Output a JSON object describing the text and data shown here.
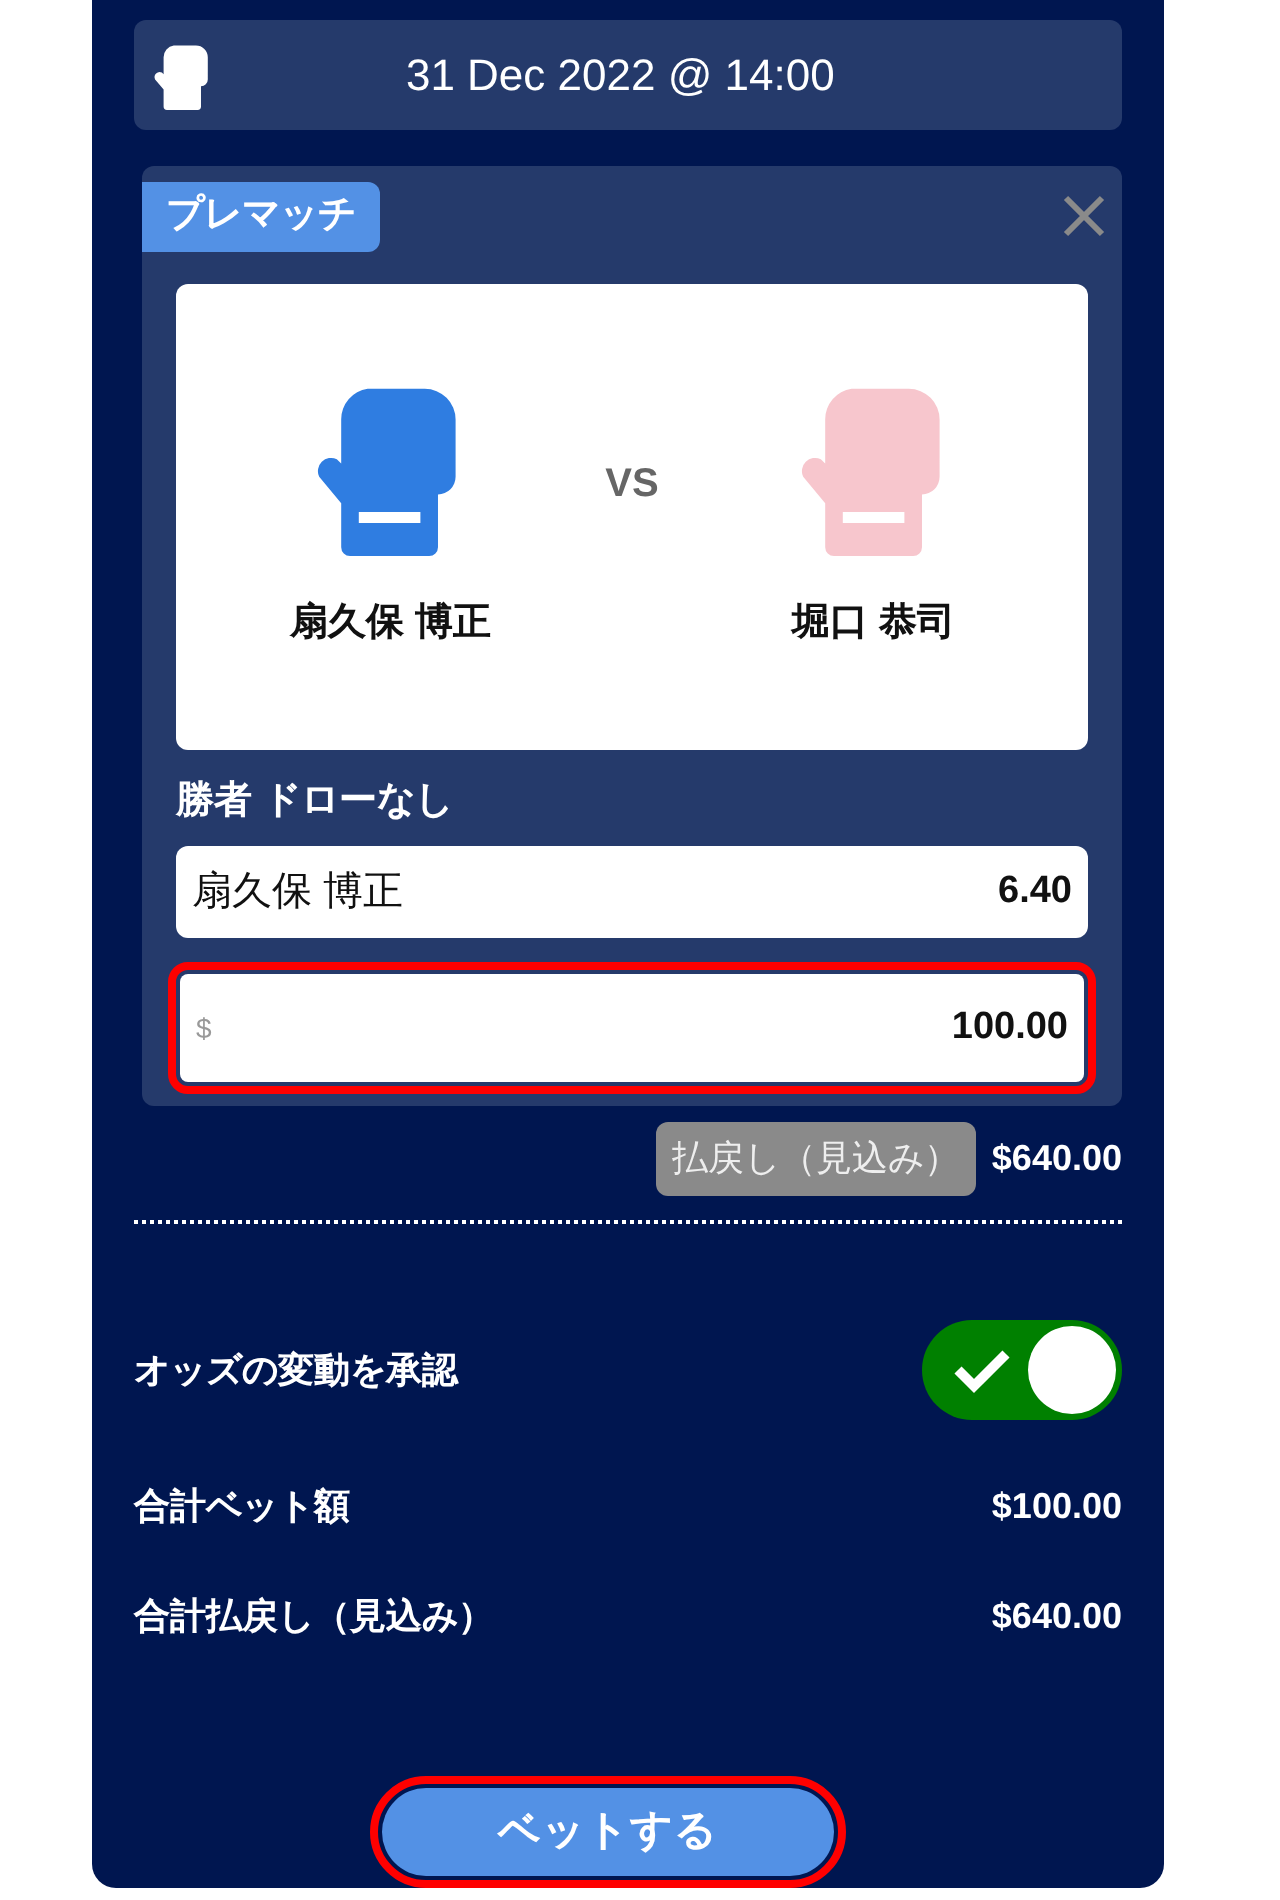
{
  "event": {
    "datetime": "31 Dec 2022 @ 14:00"
  },
  "bet": {
    "badge": "プレマッチ",
    "fighters": [
      {
        "name": "扇久保 博正",
        "color": "#2f7de1"
      },
      {
        "name": "堀口 恭司",
        "color": "#f7c6cd"
      }
    ],
    "versus": "VS",
    "market": "勝者 ドローなし",
    "selection": {
      "name": "扇久保 博正",
      "odds": "6.40"
    },
    "stake": {
      "currency": "$",
      "value": "100.00",
      "highlighted": true
    },
    "payout": {
      "label": "払戻し（見込み）",
      "value": "$640.00"
    }
  },
  "accept_odds": {
    "label": "オッズの変動を承認",
    "on": true
  },
  "totals": [
    {
      "label": "合計ベット額",
      "value": "$100.00"
    },
    {
      "label": "合計払戻し（見込み）",
      "value": "$640.00"
    }
  ],
  "place_button": {
    "label": "ベットする",
    "highlighted": true
  }
}
